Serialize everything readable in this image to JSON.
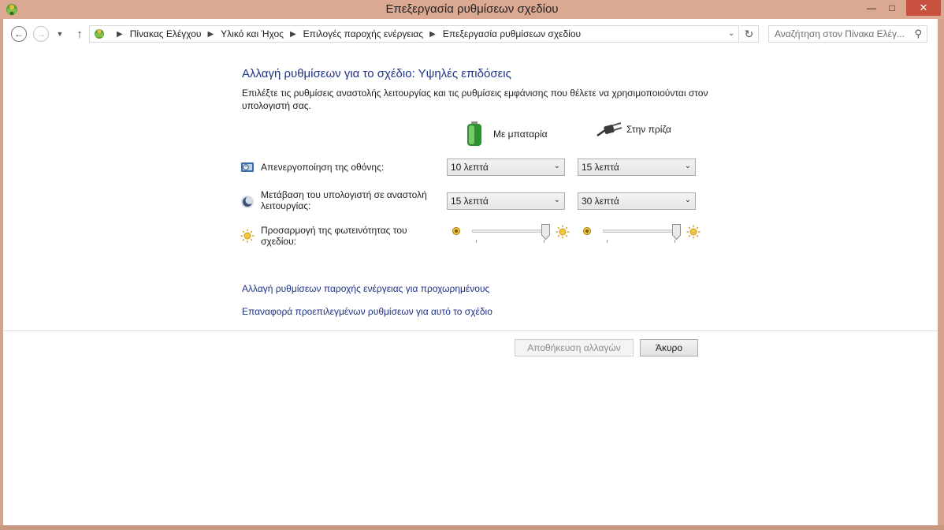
{
  "window": {
    "title": "Επεξεργασία ρυθμίσεων σχεδίου",
    "minimize_icon": "minimize-icon",
    "maximize_icon": "maximize-icon",
    "close_icon": "close-icon"
  },
  "nav": {
    "breadcrumbs": [
      "Πίνακας Ελέγχου",
      "Υλικό και Ήχος",
      "Επιλογές παροχής ενέργειας",
      "Επεξεργασία ρυθμίσεων σχεδίου"
    ],
    "search_placeholder": "Αναζήτηση στον Πίνακα Ελέγ..."
  },
  "content": {
    "heading": "Αλλαγή ρυθμίσεων για το σχέδιο: Υψηλές επιδόσεις",
    "description": "Επιλέξτε τις ρυθμίσεις αναστολής λειτουργίας και τις ρυθμίσεις εμφάνισης που θέλετε να χρησιμοποιούνται στον υπολογιστή σας.",
    "columns": {
      "battery": "Με μπαταρία",
      "plugged": "Στην πρίζα"
    },
    "rows": [
      {
        "label": "Απενεργοποίηση της οθόνης:",
        "battery_value": "10 λεπτά",
        "plugged_value": "15 λεπτά"
      },
      {
        "label": "Μετάβαση του υπολογιστή σε αναστολή λειτουργίας:",
        "battery_value": "15 λεπτά",
        "plugged_value": "30 λεπτά"
      }
    ],
    "brightness": {
      "label": "Προσαρμογή της φωτεινότητας του σχεδίου:",
      "battery_level": 1.0,
      "plugged_level": 1.0
    },
    "links": {
      "advanced": "Αλλαγή ρυθμίσεων παροχής ενέργειας για προχωρημένους",
      "restore": "Επαναφορά προεπιλεγμένων ρυθμίσεων για αυτό το σχέδιο"
    },
    "buttons": {
      "save": "Αποθήκευση αλλαγών",
      "cancel": "Άκυρο"
    }
  },
  "colors": {
    "titlebar": "#dba892",
    "close_button": "#c7503f",
    "link": "#1e3287",
    "battery_green": "#3cb043"
  }
}
